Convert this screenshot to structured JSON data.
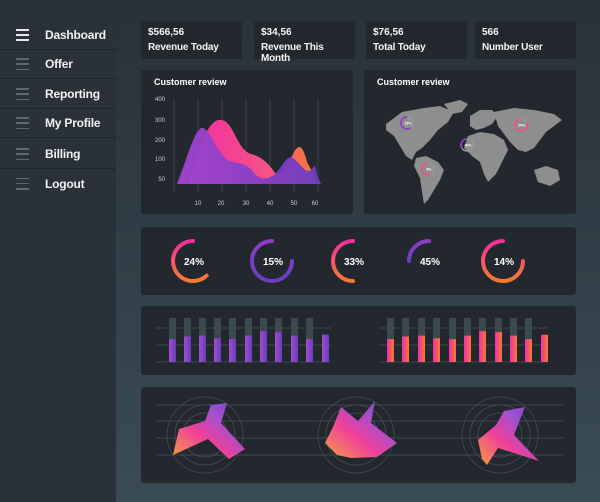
{
  "sidebar": {
    "items": [
      {
        "label": "Dashboard",
        "icon": "menu-icon",
        "active": true
      },
      {
        "label": "Offer",
        "icon": "menu-icon",
        "active": false
      },
      {
        "label": "Reporting",
        "icon": "menu-icon",
        "active": false
      },
      {
        "label": "My Profile",
        "icon": "menu-icon",
        "active": false
      },
      {
        "label": "Billing",
        "icon": "menu-icon",
        "active": false
      },
      {
        "label": "Logout",
        "icon": "menu-icon",
        "active": false
      }
    ]
  },
  "stats": [
    {
      "value": "$566,56",
      "label": "Revenue Today"
    },
    {
      "value": "$34,56",
      "label": "Revenue This Month"
    },
    {
      "value": "$76,56",
      "label": "Total Today"
    },
    {
      "value": "566",
      "label": "Number User"
    }
  ],
  "area_chart": {
    "title": "Customer review",
    "y_ticks": [
      "400",
      "300",
      "200",
      "100",
      "50"
    ],
    "x_ticks": [
      "10",
      "20",
      "30",
      "40",
      "50",
      "60"
    ]
  },
  "map_card": {
    "title": "Customer review",
    "markers": [
      {
        "region": "north-america",
        "label": "18%",
        "fraction": 0.6
      },
      {
        "region": "south-america",
        "label": "6%",
        "fraction": 0.6
      },
      {
        "region": "africa",
        "label": "40%",
        "fraction": 0.35
      },
      {
        "region": "asia",
        "label": "34%",
        "fraction": 0.8
      }
    ]
  },
  "donuts": [
    {
      "label": "24%",
      "arc": 0.62,
      "scheme": "pink-orange"
    },
    {
      "label": "15%",
      "arc": 0.75,
      "scheme": "purple"
    },
    {
      "label": "33%",
      "arc": 0.5,
      "scheme": "pink-orange"
    },
    {
      "label": "45%",
      "arc": 0.25,
      "scheme": "purple"
    },
    {
      "label": "14%",
      "arc": 0.75,
      "scheme": "pink-orange"
    }
  ],
  "bar_charts": [
    {
      "scheme": "purple",
      "values": [
        0.52,
        0.58,
        0.6,
        0.54,
        0.52,
        0.6,
        0.7,
        0.68,
        0.6,
        0.52,
        0.62
      ]
    },
    {
      "scheme": "pink-orange",
      "values": [
        0.52,
        0.58,
        0.6,
        0.54,
        0.52,
        0.6,
        0.7,
        0.68,
        0.6,
        0.52,
        0.62
      ]
    }
  ],
  "colors": {
    "pink": "#f02fa0",
    "orange": "#f77b2c",
    "purple": "#8c3fc7",
    "violet": "#6a3cc0",
    "card": "#22282d"
  }
}
